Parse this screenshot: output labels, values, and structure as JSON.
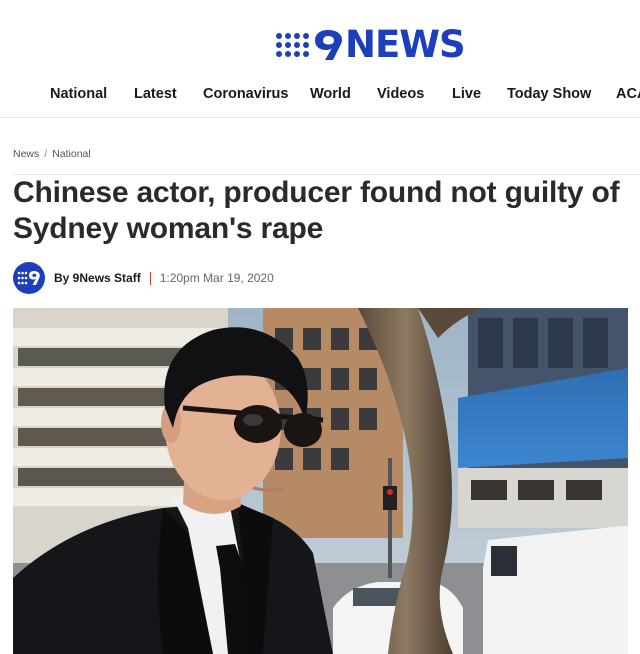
{
  "brand": {
    "logo_text": "NEWS",
    "logo_icon": "nine-dots-logo-icon",
    "color": "#1d3fbb"
  },
  "nav": {
    "items": [
      {
        "label": "National"
      },
      {
        "label": "Latest"
      },
      {
        "label": "Coronavirus"
      },
      {
        "label": "World"
      },
      {
        "label": "Videos"
      },
      {
        "label": "Live"
      },
      {
        "label": "Today Show"
      },
      {
        "label": "ACA"
      }
    ]
  },
  "breadcrumb": {
    "items": [
      "News",
      "National"
    ],
    "separator": "/"
  },
  "article": {
    "title": "Chinese actor, producer found not guilty of Sydney woman's rape",
    "byline": {
      "author": "By 9News Staff",
      "timestamp": "1:20pm Mar 19, 2020",
      "avatar_icon": "9news-avatar-icon"
    },
    "image": {
      "icon": "article-photo-image"
    }
  },
  "colors": {
    "accent_red": "#d93838",
    "brand_blue": "#1d3fbb"
  }
}
